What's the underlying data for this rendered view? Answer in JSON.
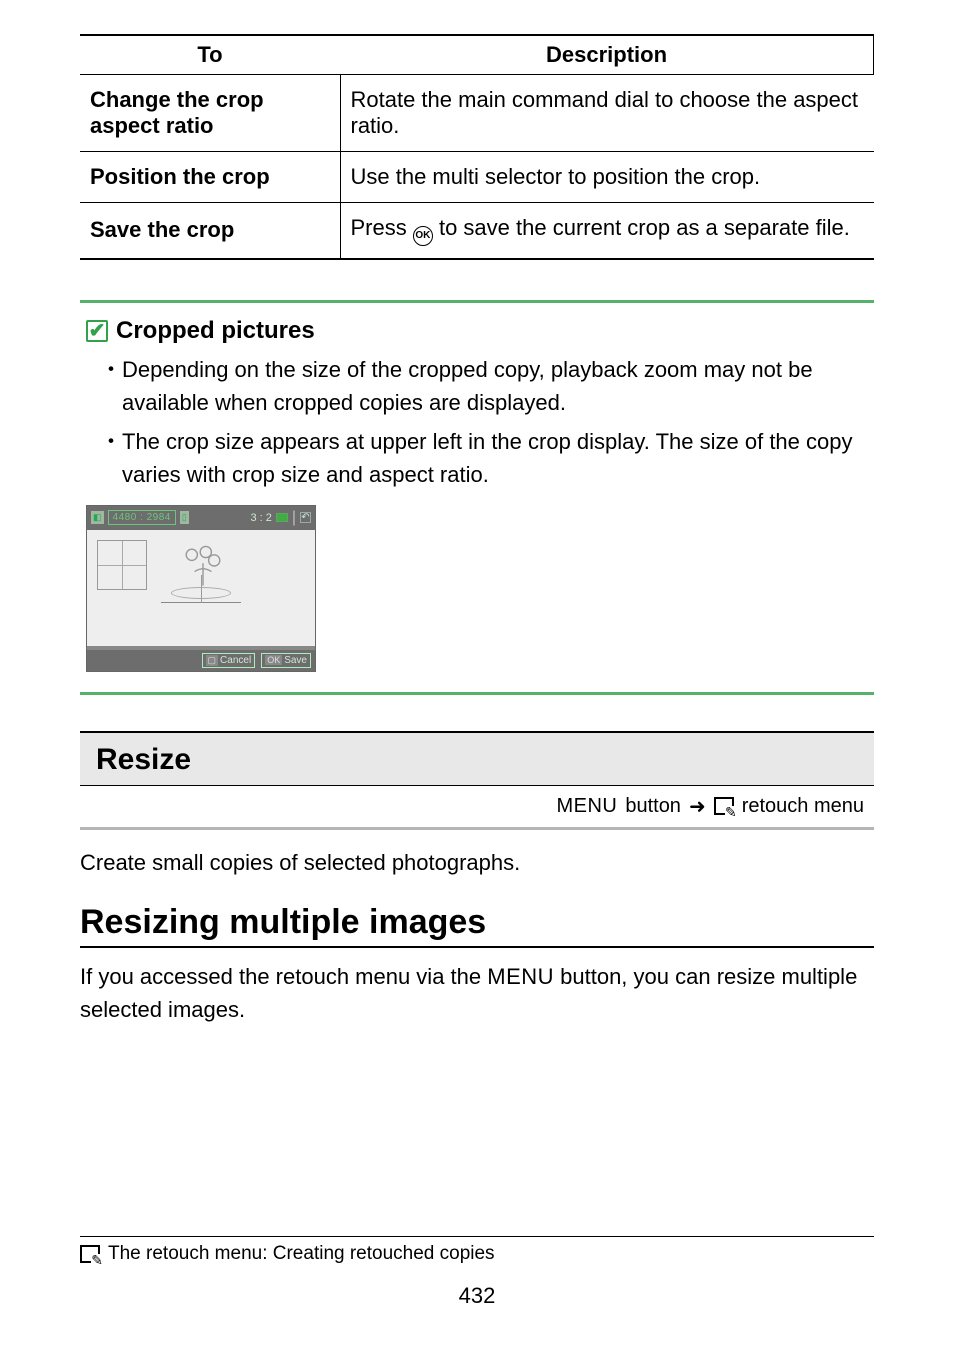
{
  "table": {
    "headers": {
      "to": "To",
      "desc": "Description"
    },
    "rows": [
      {
        "to": "Change the crop aspect ratio",
        "desc": "Rotate the main command dial to choose the aspect ratio."
      },
      {
        "to": "Position the crop",
        "desc": "Use the multi selector to position the crop."
      },
      {
        "to": "Save the crop",
        "desc_pre": "Press ",
        "desc_post": " to save the current crop as a separate file."
      }
    ]
  },
  "callout": {
    "title": "Cropped pictures",
    "bullets": [
      "Depending on the size of the cropped copy, playback zoom may not be available when cropped copies are displayed.",
      "The crop size appears at upper left in the crop display. The size of the copy varies with crop size and aspect ratio."
    ],
    "demo": {
      "dims": "4480 : 2984",
      "aspect": "3 : 2",
      "cancel": "Cancel",
      "save": "Save",
      "ok_key": "OK"
    }
  },
  "section": {
    "title": "Resize",
    "path_pre": "button",
    "path_post": "retouch menu",
    "menu_label": "MENU"
  },
  "resize_intro": "Create small copies of selected photographs.",
  "subhead": "Resizing multiple images",
  "resize_body_pre": "If you accessed the retouch menu via the ",
  "resize_body_post": " button, you can resize multiple selected images.",
  "footer": {
    "label": "The retouch menu: Creating retouched copies",
    "page": "432"
  }
}
